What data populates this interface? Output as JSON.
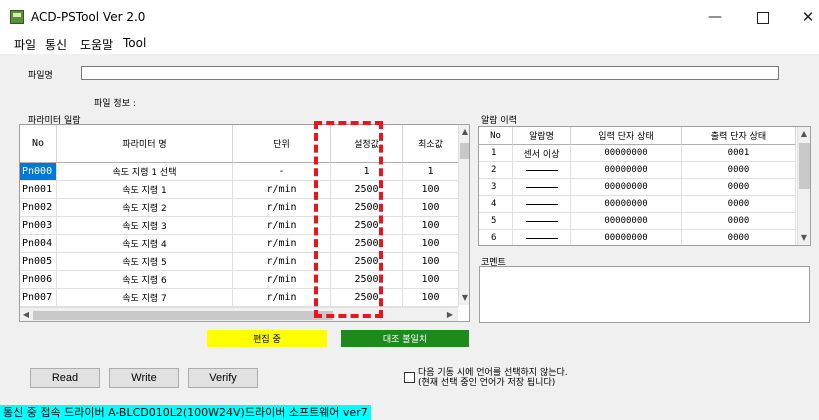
{
  "window": {
    "title": "ACD-PSTool  Ver 2.0",
    "minimize": "—",
    "close": "✕"
  },
  "menu": [
    "파일",
    "통신",
    "도움말",
    "Tool"
  ],
  "file": {
    "name_label": "파일명",
    "name_value": "",
    "info_label": "파일 정보 :"
  },
  "params": {
    "section_label": "파라미터 일람",
    "columns": [
      "No",
      "파라미터 명",
      "단위",
      "설정값",
      "최소값"
    ],
    "rows": [
      {
        "no": "Pn000",
        "name": "속도 지령 1 선택",
        "unit": "-",
        "set": "1",
        "min": "1"
      },
      {
        "no": "Pn001",
        "name": "속도 지령 1",
        "unit": "r/min",
        "set": "2500",
        "min": "100"
      },
      {
        "no": "Pn002",
        "name": "속도 지령 2",
        "unit": "r/min",
        "set": "2500",
        "min": "100"
      },
      {
        "no": "Pn003",
        "name": "속도 지령 3",
        "unit": "r/min",
        "set": "2500",
        "min": "100"
      },
      {
        "no": "Pn004",
        "name": "속도 지령 4",
        "unit": "r/min",
        "set": "2500",
        "min": "100"
      },
      {
        "no": "Pn005",
        "name": "속도 지령 5",
        "unit": "r/min",
        "set": "2500",
        "min": "100"
      },
      {
        "no": "Pn006",
        "name": "속도 지령 6",
        "unit": "r/min",
        "set": "2500",
        "min": "100"
      },
      {
        "no": "Pn007",
        "name": "속도 지령 7",
        "unit": "r/min",
        "set": "2500",
        "min": "100"
      }
    ]
  },
  "alarms": {
    "section_label": "알람 이력",
    "columns": [
      "No",
      "알람명",
      "입력 단자 상태",
      "출력 단자 상태"
    ],
    "rows": [
      {
        "no": "1",
        "name": "센서 이상",
        "input": "00000000",
        "output": "0001"
      },
      {
        "no": "2",
        "name": "",
        "input": "00000000",
        "output": "0000"
      },
      {
        "no": "3",
        "name": "",
        "input": "00000000",
        "output": "0000"
      },
      {
        "no": "4",
        "name": "",
        "input": "00000000",
        "output": "0000"
      },
      {
        "no": "5",
        "name": "",
        "input": "00000000",
        "output": "0000"
      },
      {
        "no": "6",
        "name": "",
        "input": "00000000",
        "output": "0000"
      }
    ]
  },
  "comment": {
    "label": "코멘트",
    "value": ""
  },
  "status": {
    "editing": "편집 중",
    "compare": "대조 불일치",
    "editing_color": "#ffff00",
    "compare_color": "#1e8a1e"
  },
  "buttons": {
    "read": "Read",
    "write": "Write",
    "verify": "Verify"
  },
  "language_option": {
    "line1": "다음 기동 시에 언어를 선택하지 않는다.",
    "line2": "(현재 선택 중인 언어가 저장 됩니다)",
    "checked": false
  },
  "statusbar": "통신 중  접속 드라이버  A-BLCD010L2(100W24V)드라이버 소프트웨어 ver7"
}
